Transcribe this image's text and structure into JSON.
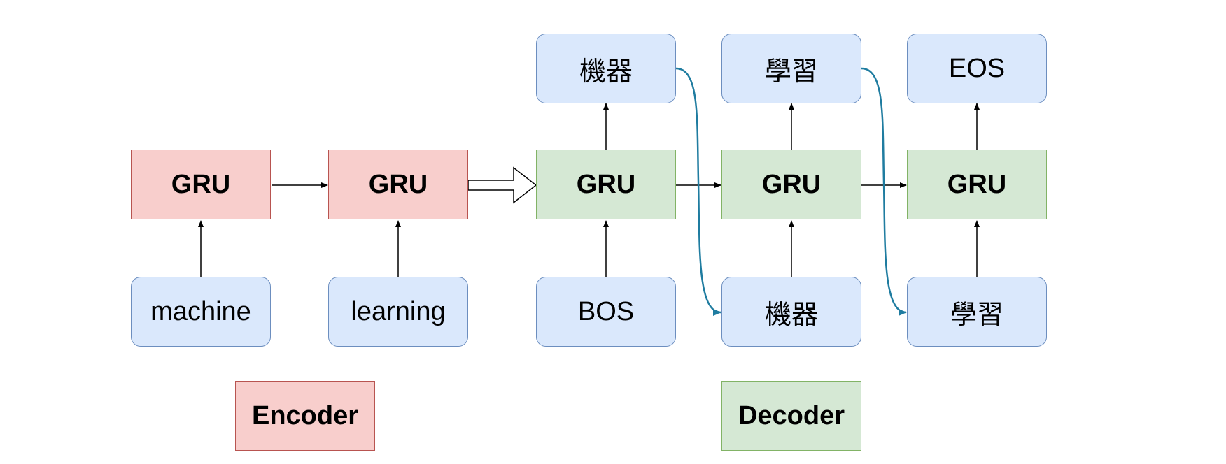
{
  "diagram": {
    "encoder": {
      "cells": [
        {
          "label": "GRU"
        },
        {
          "label": "GRU"
        }
      ],
      "inputs": [
        {
          "label": "machine"
        },
        {
          "label": "learning"
        }
      ]
    },
    "decoder": {
      "cells": [
        {
          "label": "GRU"
        },
        {
          "label": "GRU"
        },
        {
          "label": "GRU"
        }
      ],
      "inputs": [
        {
          "label": "BOS"
        },
        {
          "label": "機器"
        },
        {
          "label": "學習"
        }
      ],
      "outputs": [
        {
          "label": "機器"
        },
        {
          "label": "學習"
        },
        {
          "label": "EOS"
        }
      ]
    },
    "legend": {
      "encoder": "Encoder",
      "decoder": "Decoder"
    },
    "colors": {
      "token_fill": "#dae8fc",
      "token_stroke": "#6c8ebf",
      "encoder_fill": "#f8cecc",
      "encoder_stroke": "#b85450",
      "decoder_fill": "#d5e8d4",
      "decoder_stroke": "#82b366",
      "feedback_arrow": "#1f7ca0"
    }
  }
}
